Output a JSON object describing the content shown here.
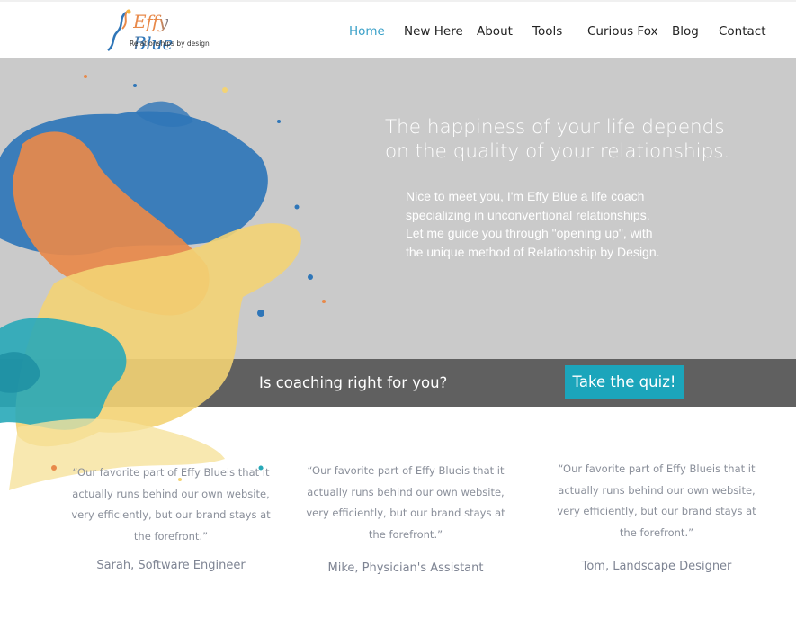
{
  "header": {
    "logo": {
      "name": "Effy Blue",
      "tagline": "Relationships by design"
    },
    "nav": [
      {
        "label": "Home",
        "active": true
      },
      {
        "label": "New Here",
        "active": false
      },
      {
        "label": "About",
        "active": false
      },
      {
        "label": "Tools",
        "active": false
      },
      {
        "label": "Curious Fox",
        "active": false
      },
      {
        "label": "Blog",
        "active": false
      },
      {
        "label": "Contact",
        "active": false
      }
    ]
  },
  "hero": {
    "headline_lines": [
      "The happiness of your life depends",
      "on the quality of your relationships."
    ],
    "intro_lines": [
      "Nice to meet you, I'm Effy Blue a life coach",
      "specializing in unconventional relationships.",
      "Let me guide you through \"opening up\", with",
      "the unique method of Relationship by Design."
    ]
  },
  "cta": {
    "question": "Is coaching right for you?",
    "button_label": "Take the quiz!"
  },
  "testimonials": [
    {
      "quote_lines": [
        "“Our favorite part of Effy Blueis that it",
        "actually runs behind our own website,",
        "very efficiently, but our brand stays at",
        "the forefront.”"
      ],
      "author": "Sarah, Software Engineer"
    },
    {
      "quote_lines": [
        "“Our favorite part of Effy Blueis that it",
        "actually runs behind our own website,",
        "very efficiently, but our brand stays at",
        "the forefront.”"
      ],
      "author": "Mike, Physician's Assistant"
    },
    {
      "quote_lines": [
        "“Our favorite part of Effy Blueis that it",
        "actually runs behind our own website,",
        "very efficiently, but our brand stays at",
        "the forefront.”"
      ],
      "author": "Tom, Landscape Designer"
    }
  ],
  "colors": {
    "accent": "#3aa0c8",
    "hero_bg": "#cacaca",
    "cta_bg": "#606060",
    "button_bg": "#1ba5bb",
    "splash_blue": "#2f76b8",
    "splash_orange": "#e8894a",
    "splash_yellow": "#f3d374",
    "splash_teal": "#28a9b8"
  }
}
